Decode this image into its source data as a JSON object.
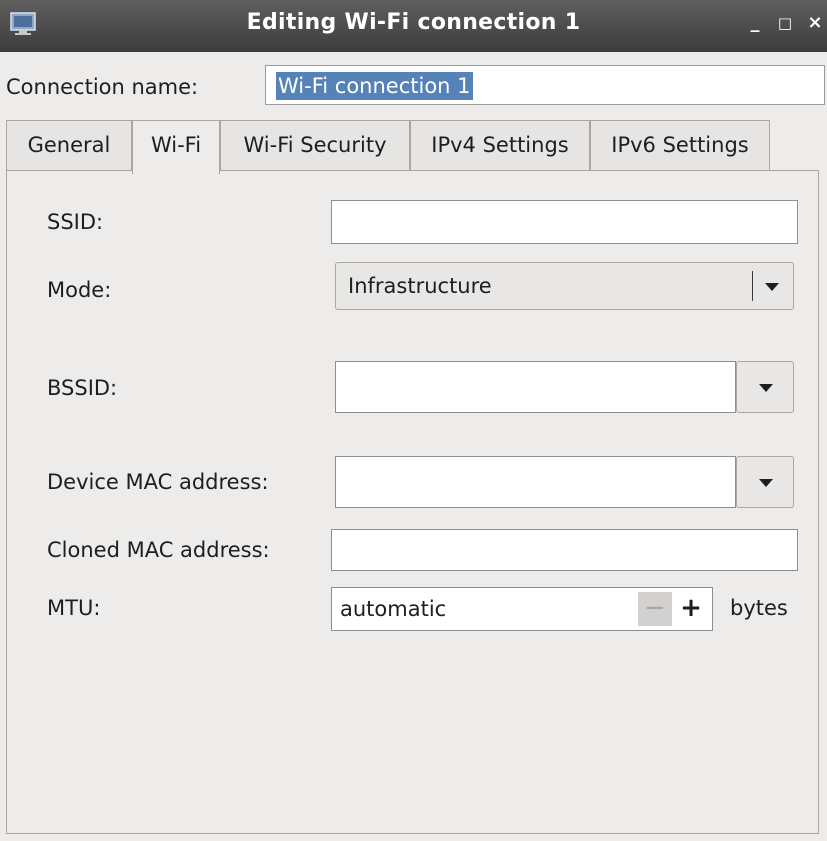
{
  "window": {
    "title": "Editing Wi-Fi connection 1",
    "controls": {
      "minimize": "_",
      "maximize": "□",
      "close": "×"
    }
  },
  "connection": {
    "label": "Connection name:",
    "value": "Wi-Fi connection 1"
  },
  "tabs": [
    {
      "label": "General",
      "active": false
    },
    {
      "label": "Wi-Fi",
      "active": true
    },
    {
      "label": "Wi-Fi Security",
      "active": false
    },
    {
      "label": "IPv4 Settings",
      "active": false
    },
    {
      "label": "IPv6 Settings",
      "active": false
    }
  ],
  "form": {
    "ssid": {
      "label": "SSID:",
      "value": ""
    },
    "mode": {
      "label": "Mode:",
      "value": "Infrastructure"
    },
    "bssid": {
      "label": "BSSID:",
      "value": ""
    },
    "device_mac": {
      "label": "Device MAC address:",
      "value": ""
    },
    "cloned_mac": {
      "label": "Cloned MAC address:",
      "value": ""
    },
    "mtu": {
      "label": "MTU:",
      "value": "automatic",
      "minus": "−",
      "plus": "+",
      "unit": "bytes"
    }
  },
  "colors": {
    "titlebar": "#4a4a4a",
    "background": "#edeceb",
    "selection": "#5583b7"
  }
}
